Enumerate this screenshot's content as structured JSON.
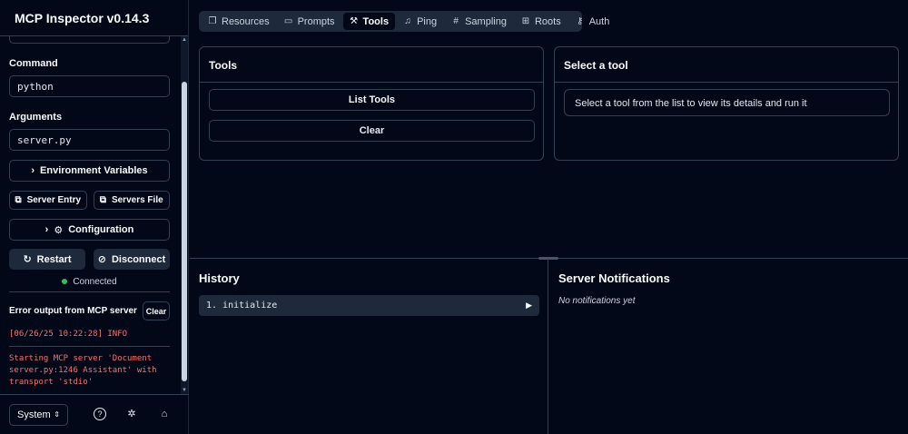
{
  "app": {
    "title": "MCP Inspector v0.14.3"
  },
  "sidebar": {
    "command_label": "Command",
    "command_value": "python",
    "arguments_label": "Arguments",
    "arguments_value": "server.py",
    "env_vars_button": "Environment Variables",
    "server_entry_button": "Server Entry",
    "servers_file_button": "Servers File",
    "configuration_button": "Configuration",
    "restart_button": "Restart",
    "disconnect_button": "Disconnect",
    "status": "Connected",
    "status_color": "#22c55e",
    "error_output_label": "Error output from MCP server",
    "clear_button": "Clear",
    "log_lines": [
      "[06/26/25 10:22:28] INFO",
      "Starting MCP server 'Document\nserver.py:1246 Assistant' with\ntransport 'stdio'"
    ],
    "log_color": "#f87171",
    "theme_select": "System"
  },
  "tabs": [
    {
      "label": "Resources",
      "icon": "files-icon"
    },
    {
      "label": "Prompts",
      "icon": "message-icon"
    },
    {
      "label": "Tools",
      "icon": "hammer-icon",
      "active": true
    },
    {
      "label": "Ping",
      "icon": "bell-icon"
    },
    {
      "label": "Sampling",
      "icon": "hash-icon"
    },
    {
      "label": "Roots",
      "icon": "folder-tree-icon"
    },
    {
      "label": "Auth",
      "icon": "key-icon"
    }
  ],
  "tools_card": {
    "title": "Tools",
    "list_button": "List Tools",
    "clear_button": "Clear"
  },
  "select_tool_card": {
    "title": "Select a tool",
    "message": "Select a tool from the list to view its details and run it"
  },
  "history": {
    "title": "History",
    "items": [
      "1. initialize"
    ]
  },
  "notifications": {
    "title": "Server Notifications",
    "empty": "No notifications yet"
  }
}
